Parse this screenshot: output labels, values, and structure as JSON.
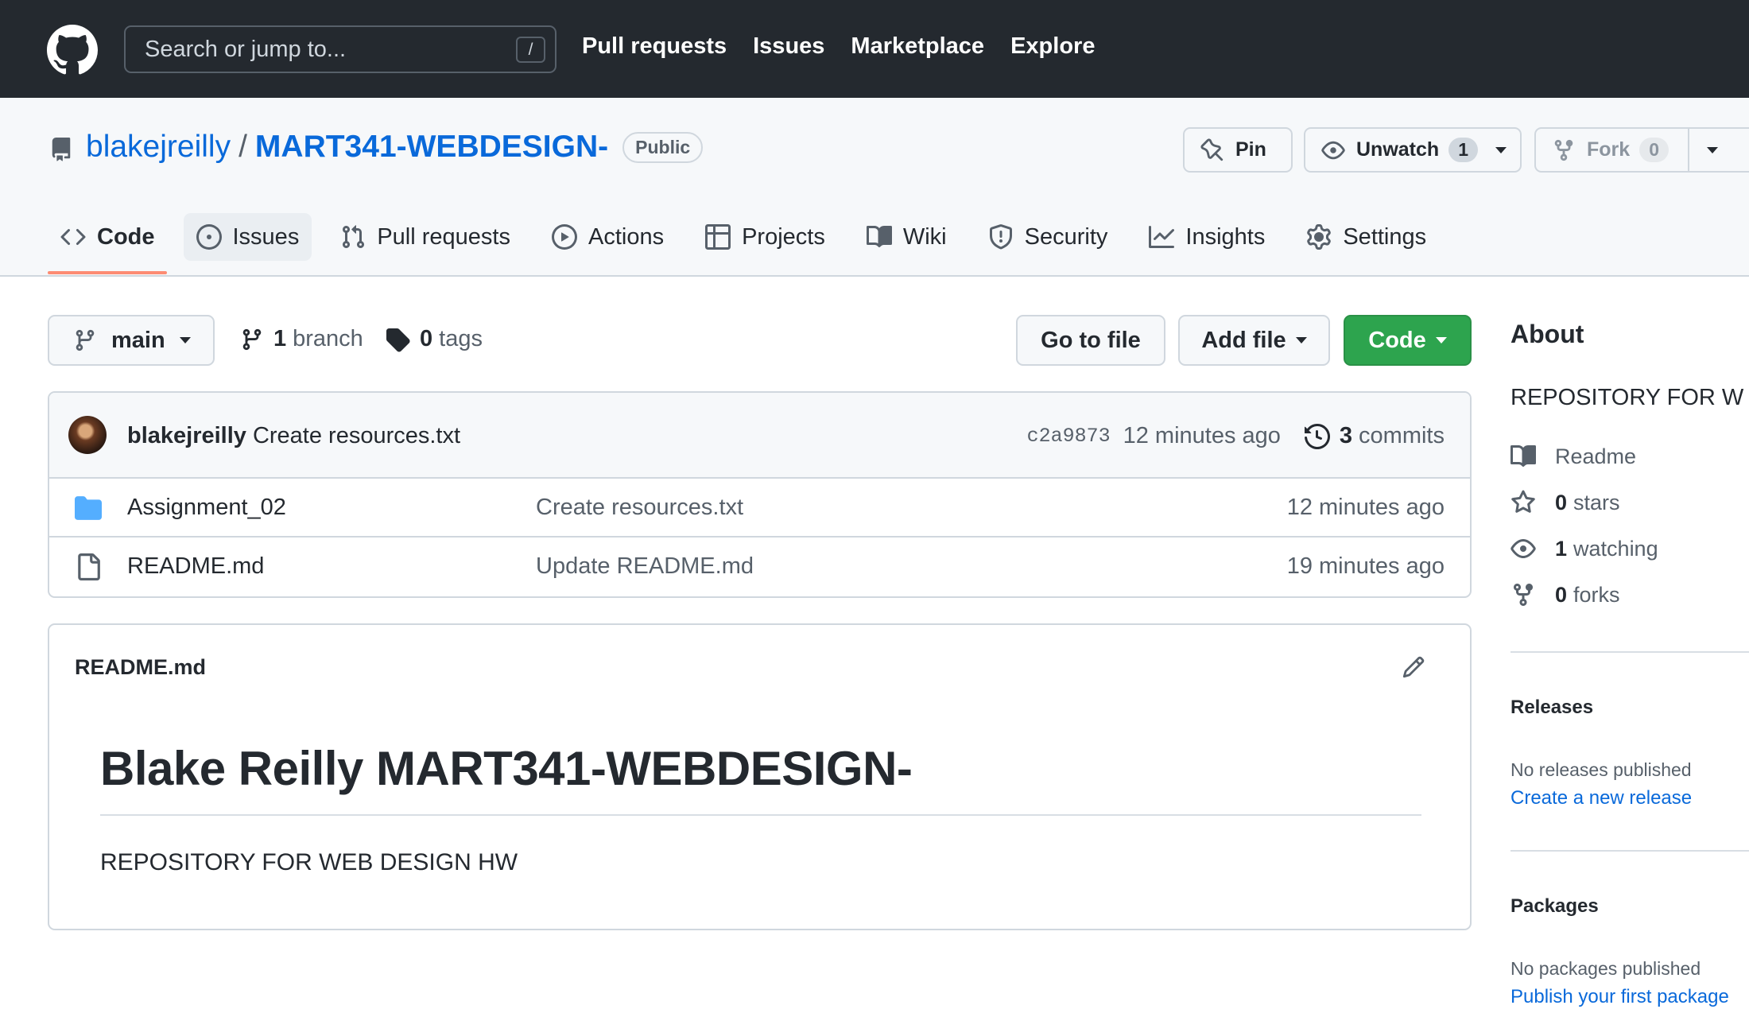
{
  "header": {
    "search_placeholder": "Search or jump to...",
    "search_shortcut": "/",
    "nav": [
      "Pull requests",
      "Issues",
      "Marketplace",
      "Explore"
    ]
  },
  "repo": {
    "owner": "blakejreilly",
    "separator": "/",
    "name": "MART341-WEBDESIGN-",
    "visibility": "Public",
    "pin_label": "Pin",
    "watch_label": "Unwatch",
    "watch_count": "1",
    "fork_label": "Fork",
    "fork_count": "0"
  },
  "tabs": [
    {
      "label": "Code",
      "icon": "code-icon"
    },
    {
      "label": "Issues",
      "icon": "issue-icon"
    },
    {
      "label": "Pull requests",
      "icon": "pull-request-icon"
    },
    {
      "label": "Actions",
      "icon": "play-icon"
    },
    {
      "label": "Projects",
      "icon": "table-icon"
    },
    {
      "label": "Wiki",
      "icon": "book-icon"
    },
    {
      "label": "Security",
      "icon": "shield-icon"
    },
    {
      "label": "Insights",
      "icon": "graph-icon"
    },
    {
      "label": "Settings",
      "icon": "gear-icon"
    }
  ],
  "branch_bar": {
    "branch": "main",
    "branch_count": "1",
    "branch_word": "branch",
    "tag_count": "0",
    "tag_word": "tags",
    "go_to_file": "Go to file",
    "add_file": "Add file",
    "code": "Code"
  },
  "latest_commit": {
    "author": "blakejreilly",
    "message": "Create resources.txt",
    "sha": "c2a9873",
    "age": "12 minutes ago",
    "commit_count": "3",
    "commit_word": "commits"
  },
  "files": [
    {
      "name": "Assignment_02",
      "type": "folder",
      "message": "Create resources.txt",
      "age": "12 minutes ago"
    },
    {
      "name": "README.md",
      "type": "file",
      "message": "Update README.md",
      "age": "19 minutes ago"
    }
  ],
  "readme": {
    "filename": "README.md",
    "heading": "Blake Reilly MART341-WEBDESIGN-",
    "body": "REPOSITORY FOR WEB DESIGN HW"
  },
  "sidebar": {
    "about_title": "About",
    "about_desc": "REPOSITORY FOR W",
    "readme_label": "Readme",
    "stars_count": "0",
    "stars_word": "stars",
    "watching_count": "1",
    "watching_word": "watching",
    "forks_count": "0",
    "forks_word": "forks",
    "releases_title": "Releases",
    "releases_empty": "No releases published",
    "releases_link": "Create a new release",
    "packages_title": "Packages",
    "packages_empty": "No packages published",
    "packages_link": "Publish your first package"
  },
  "colors": {
    "header_bg": "#24292f",
    "link": "#0969da",
    "primary_button": "#2da44e",
    "active_tab_underline": "#fd8c73",
    "folder": "#54aeff"
  }
}
